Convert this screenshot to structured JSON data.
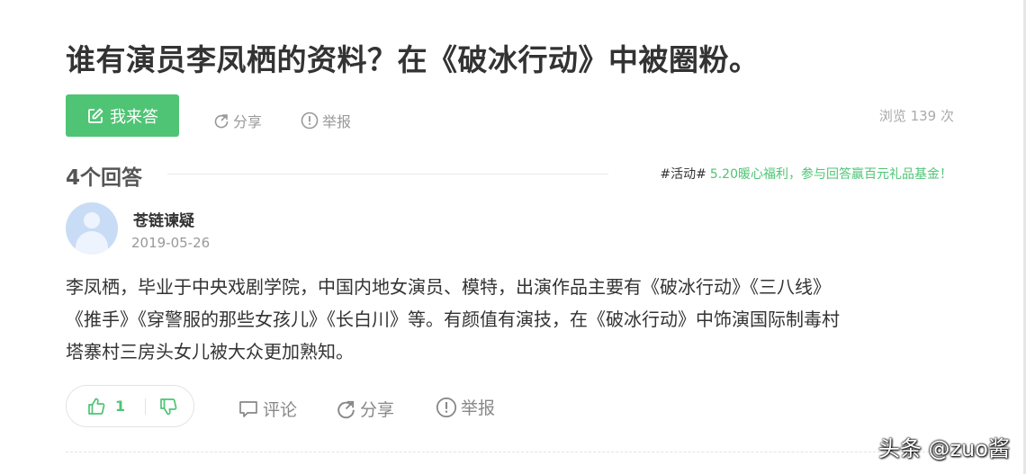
{
  "question": {
    "title": "谁有演员李凤栖的资料？在《破冰行动》中被圈粉。"
  },
  "actions": {
    "answer_label": "我来答",
    "share_label": "分享",
    "report_label": "举报",
    "views_text": "浏览 139 次"
  },
  "answers_header": {
    "count_label": "4个回答",
    "activity_tag": "#活动#",
    "activity_text": "5.20暖心福利，参与回答赢百元礼品基金！"
  },
  "answer": {
    "author": "苍链谏疑",
    "date": "2019-05-26",
    "lines": [
      "李凤栖，毕业于中央戏剧学院，中国内地女演员、模特，出演作品主要有《破冰行动》《三八线》",
      "《推手》《穿警服的那些女孩儿》《长白川》等。有颜值有演技，在《破冰行动》中饰演国际制毒村",
      "塔寨村三房头女儿被大众更加熟知。"
    ],
    "like_count": "1",
    "comment_label": "评论",
    "share_label": "分享",
    "report_label": "举报"
  },
  "watermark": "头条 @zuo酱",
  "colors": {
    "accent_green": "#4fc475",
    "muted_gray": "#999999",
    "avatar_blue": "#c9dcf6"
  },
  "icons": [
    "edit-icon",
    "share-icon",
    "report-icon",
    "thumbs-up-icon",
    "thumbs-down-icon",
    "comment-icon",
    "avatar-placeholder"
  ]
}
